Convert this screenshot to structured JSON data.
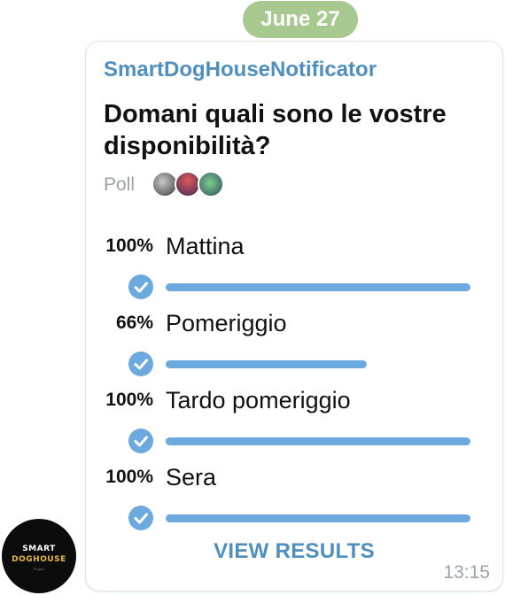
{
  "date_label": "June 27",
  "message": {
    "sender": "SmartDogHouseNotificator",
    "question": "Domani quali sono le vostre disponibilità?",
    "poll_label": "Poll",
    "voters": [
      "voter-avatar-1",
      "voter-avatar-2",
      "voter-avatar-3"
    ],
    "options": [
      {
        "percent_label": "100%",
        "label": "Mattina",
        "fraction": 1.0,
        "checked": true
      },
      {
        "percent_label": "66%",
        "label": "Pomeriggio",
        "fraction": 0.66,
        "checked": true
      },
      {
        "percent_label": "100%",
        "label": "Tardo pomeriggio",
        "fraction": 1.0,
        "checked": true
      },
      {
        "percent_label": "100%",
        "label": "Sera",
        "fraction": 1.0,
        "checked": true
      }
    ],
    "view_results_label": "VIEW RESULTS",
    "time": "13:15"
  },
  "sender_avatar": {
    "logo_line1": "SMART",
    "logo_line2": "DOGHOUSE",
    "logo_line3": "Project"
  },
  "colors": {
    "accent": "#4f8fc0",
    "bar": "#6ba9df",
    "date_pill": "#a7c88e",
    "muted": "#9aa3aa"
  }
}
